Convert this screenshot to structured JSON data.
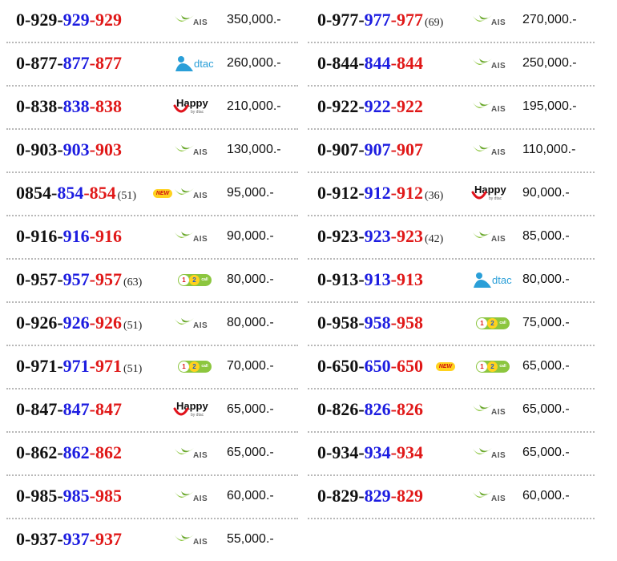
{
  "columns": [
    {
      "rows": [
        {
          "parts": [
            "0-929-",
            "929",
            "-929"
          ],
          "sum": "",
          "new": false,
          "op": "ais",
          "price": "350,000.-"
        },
        {
          "parts": [
            "0-877-",
            "877",
            "-877"
          ],
          "sum": "",
          "new": false,
          "op": "dtac",
          "price": "260,000.-"
        },
        {
          "parts": [
            "0-838-",
            "838",
            "-838"
          ],
          "sum": "",
          "new": false,
          "op": "happy",
          "price": "210,000.-"
        },
        {
          "parts": [
            "0-903-",
            "903",
            "-903"
          ],
          "sum": "",
          "new": false,
          "op": "ais",
          "price": "130,000.-"
        },
        {
          "parts": [
            "0854-",
            "854",
            "-854"
          ],
          "sum": "(51)",
          "new": true,
          "op": "ais",
          "price": "95,000.-"
        },
        {
          "parts": [
            "0-916-",
            "916",
            "-916"
          ],
          "sum": "",
          "new": false,
          "op": "ais",
          "price": "90,000.-"
        },
        {
          "parts": [
            "0-957-",
            "957",
            "-957"
          ],
          "sum": "(63)",
          "new": false,
          "op": "12call",
          "price": "80,000.-"
        },
        {
          "parts": [
            "0-926-",
            "926",
            "-926"
          ],
          "sum": "(51)",
          "new": false,
          "op": "ais",
          "price": "80,000.-"
        },
        {
          "parts": [
            "0-971-",
            "971",
            "-971"
          ],
          "sum": "(51)",
          "new": false,
          "op": "12call",
          "price": "70,000.-"
        },
        {
          "parts": [
            "0-847-",
            "847",
            "-847"
          ],
          "sum": "",
          "new": false,
          "op": "happy",
          "price": "65,000.-"
        },
        {
          "parts": [
            "0-862-",
            "862",
            "-862"
          ],
          "sum": "",
          "new": false,
          "op": "ais",
          "price": "65,000.-"
        },
        {
          "parts": [
            "0-985-",
            "985",
            "-985"
          ],
          "sum": "",
          "new": false,
          "op": "ais",
          "price": "60,000.-"
        },
        {
          "parts": [
            "0-937-",
            "937",
            "-937"
          ],
          "sum": "",
          "new": false,
          "op": "ais",
          "price": "55,000.-"
        }
      ]
    },
    {
      "rows": [
        {
          "parts": [
            "0-977-",
            "977",
            "-977"
          ],
          "sum": "(69)",
          "new": false,
          "op": "ais",
          "price": "270,000.-"
        },
        {
          "parts": [
            "0-844-",
            "844",
            "-844"
          ],
          "sum": "",
          "new": false,
          "op": "ais",
          "price": "250,000.-"
        },
        {
          "parts": [
            "0-922-",
            "922",
            "-922"
          ],
          "sum": "",
          "new": false,
          "op": "ais",
          "price": "195,000.-"
        },
        {
          "parts": [
            "0-907-",
            "907",
            "-907"
          ],
          "sum": "",
          "new": false,
          "op": "ais",
          "price": "110,000.-"
        },
        {
          "parts": [
            "0-912-",
            "912",
            "-912"
          ],
          "sum": "(36)",
          "new": false,
          "op": "happy",
          "price": "90,000.-"
        },
        {
          "parts": [
            "0-923-",
            "923",
            "-923"
          ],
          "sum": "(42)",
          "new": false,
          "op": "ais",
          "price": "85,000.-"
        },
        {
          "parts": [
            "0-913-",
            "913",
            "-913"
          ],
          "sum": "",
          "new": false,
          "op": "dtac",
          "price": "80,000.-"
        },
        {
          "parts": [
            "0-958-",
            "958",
            "-958"
          ],
          "sum": "",
          "new": false,
          "op": "12call",
          "price": "75,000.-"
        },
        {
          "parts": [
            "0-650-",
            "650",
            "-650"
          ],
          "sum": "",
          "new": true,
          "op": "12call",
          "price": "65,000.-"
        },
        {
          "parts": [
            "0-826-",
            "826",
            "-826"
          ],
          "sum": "",
          "new": false,
          "op": "ais",
          "price": "65,000.-"
        },
        {
          "parts": [
            "0-934-",
            "934",
            "-934"
          ],
          "sum": "",
          "new": false,
          "op": "ais",
          "price": "65,000.-"
        },
        {
          "parts": [
            "0-829-",
            "829",
            "-829"
          ],
          "sum": "",
          "new": false,
          "op": "ais",
          "price": "60,000.-"
        }
      ]
    }
  ],
  "labels": {
    "new_badge": "NEW",
    "ais": "AIS",
    "dtac": "dtac",
    "happy": "Happy",
    "happy_sub": "by dtac",
    "call12_digits": [
      "1",
      "2",
      "call"
    ]
  },
  "colors": {
    "prefix": "#111111",
    "middle": "#1c1ce0",
    "suffix": "#e01818",
    "ais_green": "#8cc63f",
    "dtac_blue": "#2a9fd8",
    "happy_red": "#e0121b",
    "new_badge": "#ffd21e"
  }
}
